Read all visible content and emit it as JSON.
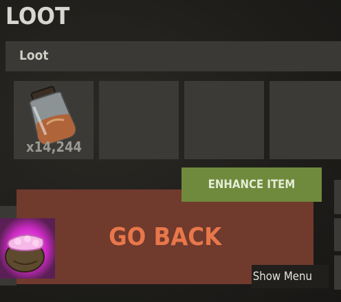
{
  "header": {
    "title": "LOOT"
  },
  "section": {
    "label": "Loot"
  },
  "slots": [
    {
      "item": "jar-icon",
      "quantity": "x14,244"
    },
    {
      "item": "",
      "quantity": ""
    },
    {
      "item": "",
      "quantity": ""
    },
    {
      "item": "",
      "quantity": ""
    }
  ],
  "actions": {
    "enhance_label": "ENHANCE ITEM",
    "go_back_label": "GO BACK",
    "show_menu_label": "Show Menu"
  },
  "colors": {
    "enhance": "#6f8a3d",
    "go_back_bg": "#703a2d",
    "go_back_text": "#e8774a",
    "glow": "#e040e0"
  },
  "side_item": {
    "icon": "pouch-icon"
  }
}
